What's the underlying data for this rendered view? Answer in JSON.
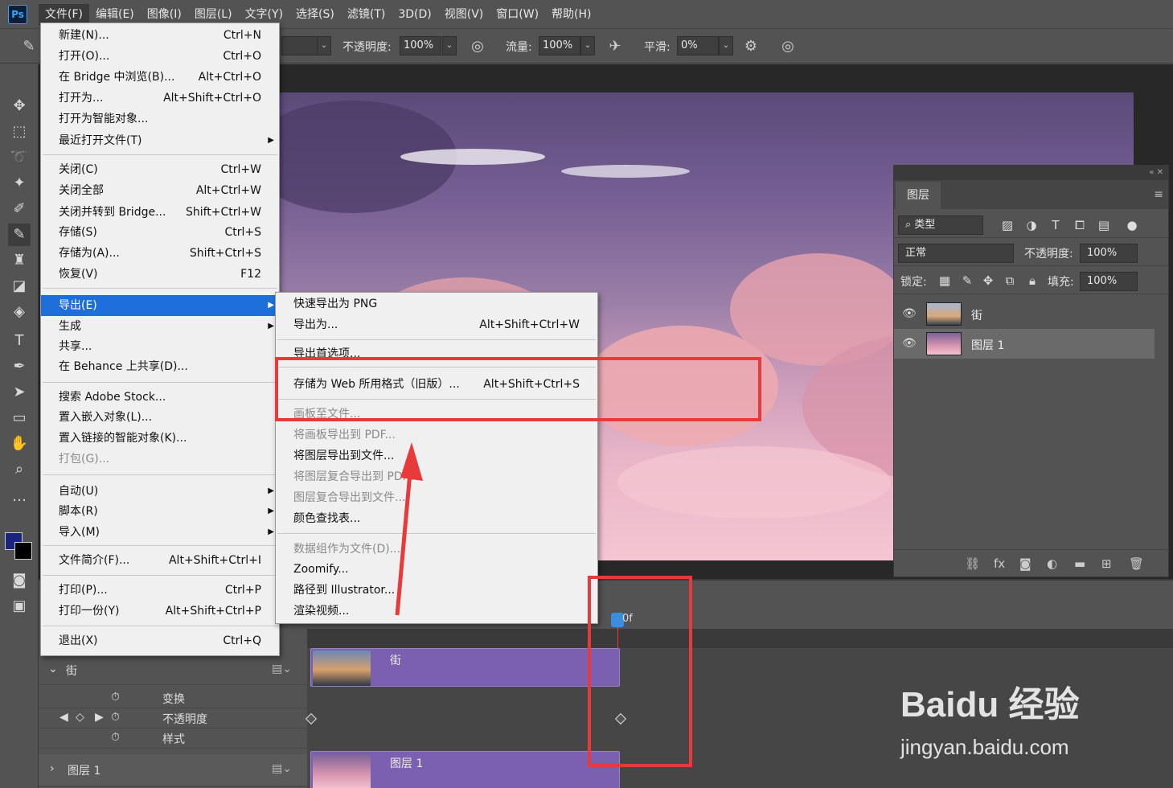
{
  "app": {
    "logo": "Ps"
  },
  "menubar": [
    "文件(F)",
    "编辑(E)",
    "图像(I)",
    "图层(L)",
    "文字(Y)",
    "选择(S)",
    "滤镜(T)",
    "3D(D)",
    "视图(V)",
    "窗口(W)",
    "帮助(H)"
  ],
  "options": {
    "opacity_label": "不透明度:",
    "opacity_value": "100%",
    "flow_label": "流量:",
    "flow_value": "100%",
    "smooth_label": "平滑:",
    "smooth_value": "0%"
  },
  "file_menu": [
    {
      "label": "新建(N)...",
      "shortcut": "Ctrl+N"
    },
    {
      "label": "打开(O)...",
      "shortcut": "Ctrl+O"
    },
    {
      "label": "在 Bridge 中浏览(B)...",
      "shortcut": "Alt+Ctrl+O"
    },
    {
      "label": "打开为...",
      "shortcut": "Alt+Shift+Ctrl+O"
    },
    {
      "label": "打开为智能对象...",
      "shortcut": ""
    },
    {
      "label": "最近打开文件(T)",
      "shortcut": ""
    },
    {
      "label": "关闭(C)",
      "shortcut": "Ctrl+W"
    },
    {
      "label": "关闭全部",
      "shortcut": "Alt+Ctrl+W"
    },
    {
      "label": "关闭并转到 Bridge...",
      "shortcut": "Shift+Ctrl+W"
    },
    {
      "label": "存储(S)",
      "shortcut": "Ctrl+S"
    },
    {
      "label": "存储为(A)...",
      "shortcut": "Shift+Ctrl+S"
    },
    {
      "label": "恢复(V)",
      "shortcut": "F12"
    },
    {
      "label": "导出(E)",
      "shortcut": ""
    },
    {
      "label": "生成",
      "shortcut": ""
    },
    {
      "label": "共享...",
      "shortcut": ""
    },
    {
      "label": "在 Behance 上共享(D)...",
      "shortcut": ""
    },
    {
      "label": "搜索 Adobe Stock...",
      "shortcut": ""
    },
    {
      "label": "置入嵌入对象(L)...",
      "shortcut": ""
    },
    {
      "label": "置入链接的智能对象(K)...",
      "shortcut": ""
    },
    {
      "label": "打包(G)...",
      "shortcut": ""
    },
    {
      "label": "自动(U)",
      "shortcut": ""
    },
    {
      "label": "脚本(R)",
      "shortcut": ""
    },
    {
      "label": "导入(M)",
      "shortcut": ""
    },
    {
      "label": "文件简介(F)...",
      "shortcut": "Alt+Shift+Ctrl+I"
    },
    {
      "label": "打印(P)...",
      "shortcut": "Ctrl+P"
    },
    {
      "label": "打印一份(Y)",
      "shortcut": "Alt+Shift+Ctrl+P"
    },
    {
      "label": "退出(X)",
      "shortcut": "Ctrl+Q"
    }
  ],
  "export_menu": [
    {
      "label": "快速导出为 PNG",
      "shortcut": ""
    },
    {
      "label": "导出为...",
      "shortcut": "Alt+Shift+Ctrl+W"
    },
    {
      "label": "导出首选项...",
      "shortcut": ""
    },
    {
      "label": "存储为 Web 所用格式（旧版）...",
      "shortcut": "Alt+Shift+Ctrl+S"
    },
    {
      "label": "画板至文件...",
      "shortcut": ""
    },
    {
      "label": "将画板导出到 PDF...",
      "shortcut": ""
    },
    {
      "label": "将图层导出到文件...",
      "shortcut": ""
    },
    {
      "label": "将图层复合导出到 PDF...",
      "shortcut": ""
    },
    {
      "label": "图层复合导出到文件...",
      "shortcut": ""
    },
    {
      "label": "颜色查找表...",
      "shortcut": ""
    },
    {
      "label": "数据组作为文件(D)...",
      "shortcut": ""
    },
    {
      "label": "Zoomify...",
      "shortcut": ""
    },
    {
      "label": "路径到 Illustrator...",
      "shortcut": ""
    },
    {
      "label": "渲染视频...",
      "shortcut": ""
    }
  ],
  "layers": {
    "tab": "图层",
    "filter": "类型",
    "blend": "正常",
    "opacity_label": "不透明度:",
    "opacity_value": "100%",
    "lock_label": "锁定:",
    "fill_label": "填充:",
    "fill_value": "100%",
    "items": [
      {
        "name": "街",
        "selected": false
      },
      {
        "name": "图层 1",
        "selected": true
      }
    ]
  },
  "timeline": {
    "time_marker": "0f",
    "group1": "街",
    "props": [
      "变换",
      "不透明度",
      "样式"
    ],
    "group2": "图层 1",
    "clip1": "街",
    "clip2": "图层 1"
  },
  "watermark": {
    "brand": "Baidu 经验",
    "url": "jingyan.baidu.com"
  }
}
